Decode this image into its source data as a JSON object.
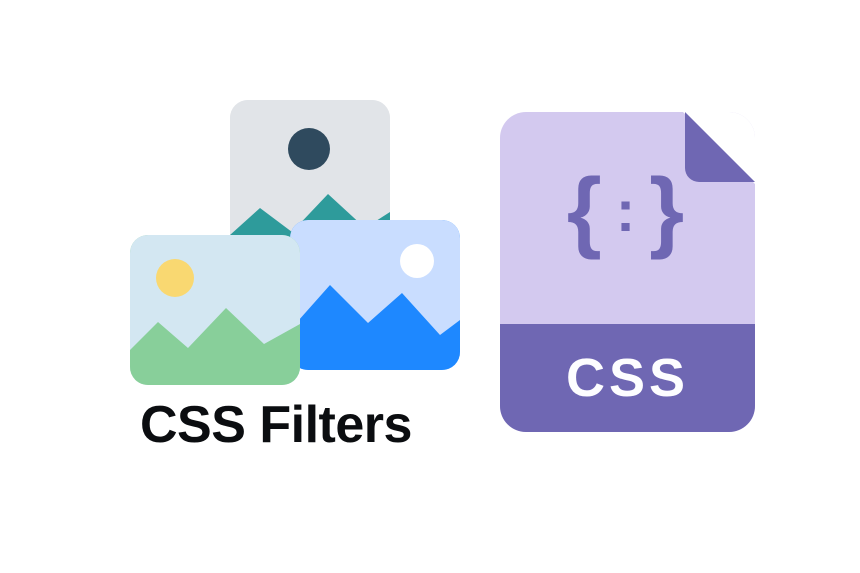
{
  "title": "CSS Filters",
  "file_label": "CSS",
  "braces": {
    "left": "{",
    "colon": ":",
    "right": "}"
  }
}
